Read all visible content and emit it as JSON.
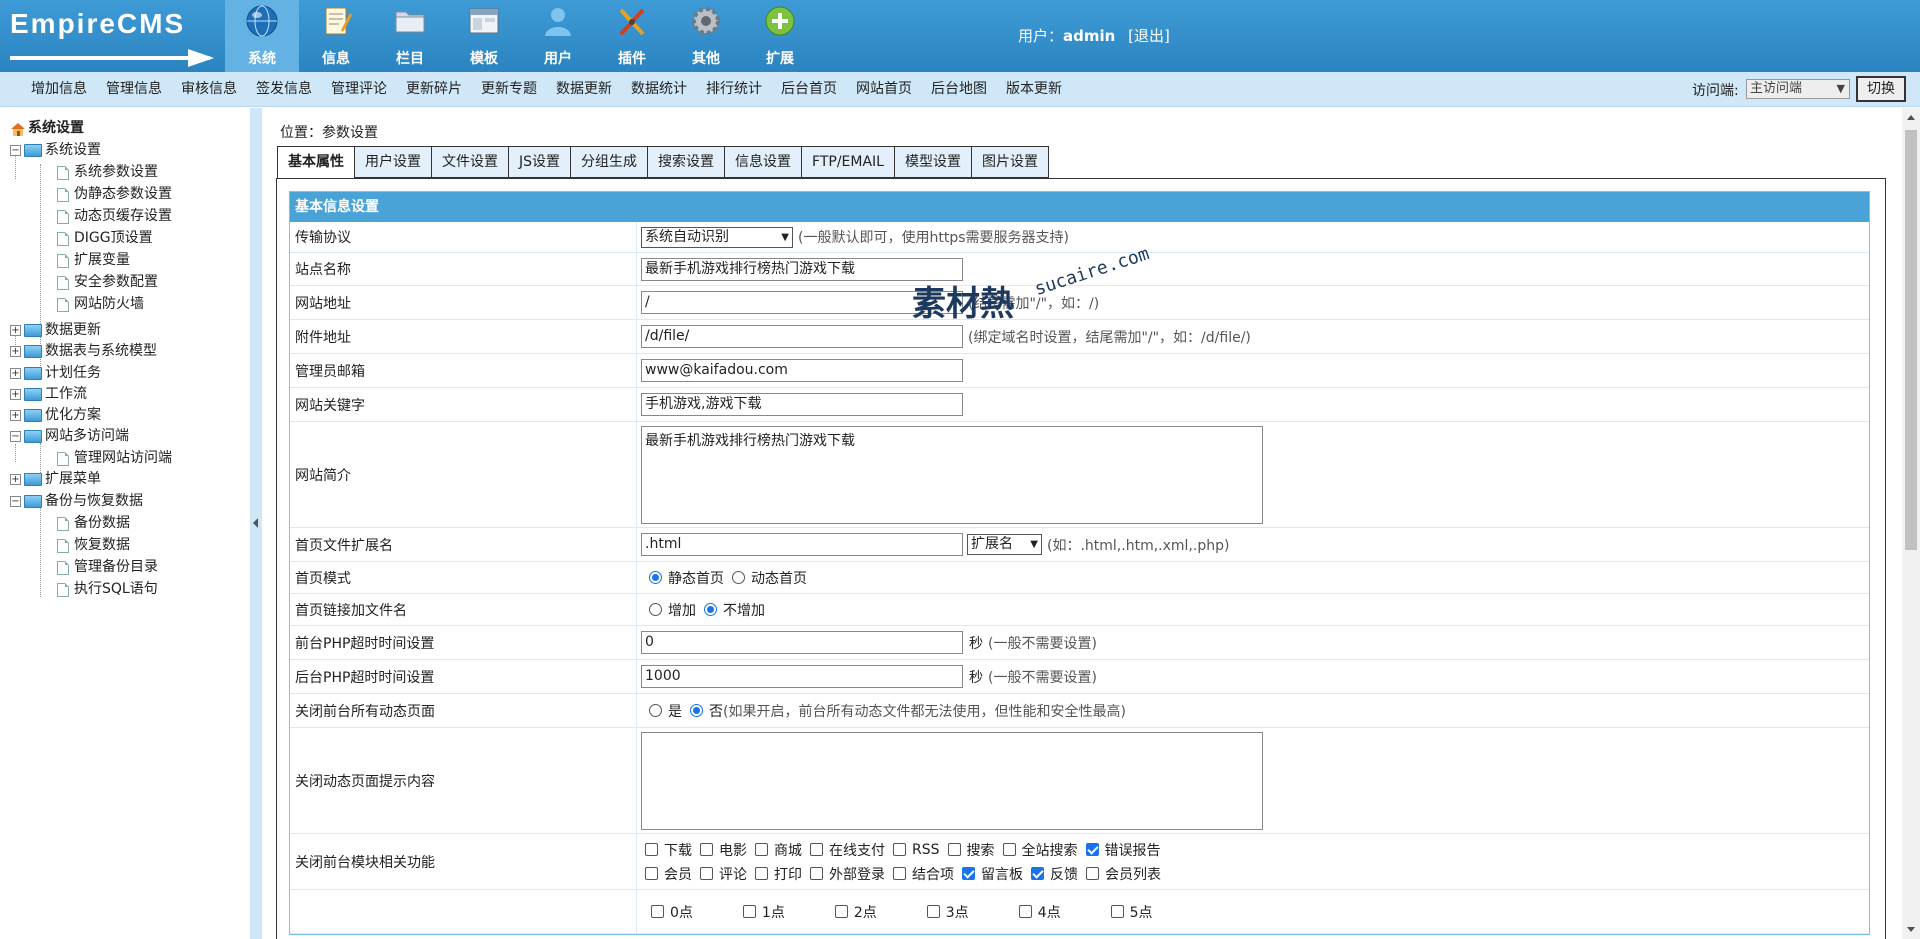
{
  "brand": {
    "logo_text": "EmpireCMS"
  },
  "main_nav": [
    {
      "label": "系统",
      "icon": "globe-icon"
    },
    {
      "label": "信息",
      "icon": "document-pen-icon"
    },
    {
      "label": "栏目",
      "icon": "folder-icon"
    },
    {
      "label": "模板",
      "icon": "window-template-icon"
    },
    {
      "label": "用户",
      "icon": "user-icon"
    },
    {
      "label": "插件",
      "icon": "tools-icon"
    },
    {
      "label": "其他",
      "icon": "gear-icon"
    },
    {
      "label": "扩展",
      "icon": "plus-circle-icon"
    }
  ],
  "user": {
    "prefix": "用户：",
    "name": "admin",
    "logout": "[退出]"
  },
  "sub_nav": [
    "增加信息",
    "管理信息",
    "审核信息",
    "签发信息",
    "管理评论",
    "更新碎片",
    "更新专题",
    "数据更新",
    "数据统计",
    "排行统计",
    "后台首页",
    "网站首页",
    "后台地图",
    "版本更新"
  ],
  "visit": {
    "label": "访问端:",
    "selected": "主访问端",
    "switch_label": "切换"
  },
  "sidebar": {
    "root": "系统设置",
    "items": [
      {
        "label": "系统设置",
        "level": 1,
        "open": true
      },
      {
        "label": "系统参数设置",
        "level": 2
      },
      {
        "label": "伪静态参数设置",
        "level": 2
      },
      {
        "label": "动态页缓存设置",
        "level": 2
      },
      {
        "label": "DIGG顶设置",
        "level": 2
      },
      {
        "label": "扩展变量",
        "level": 2
      },
      {
        "label": "安全参数配置",
        "level": 2
      },
      {
        "label": "网站防火墙",
        "level": 2
      },
      {
        "label": "数据更新",
        "level": 1,
        "open": false
      },
      {
        "label": "数据表与系统模型",
        "level": 1,
        "open": false
      },
      {
        "label": "计划任务",
        "level": 1,
        "open": false
      },
      {
        "label": "工作流",
        "level": 1,
        "open": false
      },
      {
        "label": "优化方案",
        "level": 1,
        "open": false
      },
      {
        "label": "网站多访问端",
        "level": 1,
        "open": true
      },
      {
        "label": "管理网站访问端",
        "level": 2
      },
      {
        "label": "扩展菜单",
        "level": 1,
        "open": false
      },
      {
        "label": "备份与恢复数据",
        "level": 1,
        "open": true
      },
      {
        "label": "备份数据",
        "level": 2
      },
      {
        "label": "恢复数据",
        "level": 2
      },
      {
        "label": "管理备份目录",
        "level": 2
      },
      {
        "label": "执行SQL语句",
        "level": 2
      }
    ]
  },
  "breadcrumb": {
    "prefix": "位置：",
    "current": "参数设置"
  },
  "tabs": [
    "基本属性",
    "用户设置",
    "文件设置",
    "JS设置",
    "分组生成",
    "搜索设置",
    "信息设置",
    "FTP/EMAIL",
    "模型设置",
    "图片设置"
  ],
  "form": {
    "section_title": "基本信息设置",
    "protocol": {
      "label": "传输协议",
      "value": "系统自动识别",
      "hint": "(一般默认即可，使用https需要服务器支持)"
    },
    "site_name": {
      "label": "站点名称",
      "value": "最新手机游戏排行榜热门游戏下载"
    },
    "site_url": {
      "label": "网站地址",
      "value": "/",
      "hint": "(结尾需加\"/\"，如：/)"
    },
    "attach_url": {
      "label": "附件地址",
      "value": "/d/file/",
      "hint": "(绑定域名时设置，结尾需加\"/\"，如：/d/file/)"
    },
    "admin_email": {
      "label": "管理员邮箱",
      "value": "www@kaifadou.com"
    },
    "keywords": {
      "label": "网站关键字",
      "value": "手机游戏,游戏下载"
    },
    "intro": {
      "label": "网站简介",
      "value": "最新手机游戏排行榜热门游戏下载"
    },
    "index_ext": {
      "label": "首页文件扩展名",
      "value": ".html",
      "select": "扩展名",
      "hint": "(如：.html,.htm,.xml,.php)"
    },
    "index_mode": {
      "label": "首页模式",
      "opt1": "静态首页",
      "opt2": "动态首页",
      "selected": "静态首页"
    },
    "index_link": {
      "label": "首页链接加文件名",
      "opt1": "增加",
      "opt2": "不增加",
      "selected": "不增加"
    },
    "front_timeout": {
      "label": "前台PHP超时时间设置",
      "value": "0",
      "unit": "秒",
      "hint": "(一般不需要设置)"
    },
    "back_timeout": {
      "label": "后台PHP超时时间设置",
      "value": "1000",
      "unit": "秒",
      "hint": "(一般不需要设置)"
    },
    "close_dynamic": {
      "label": "关闭前台所有动态页面",
      "opt1": "是",
      "opt2": "否",
      "selected": "否",
      "hint": "(如果开启，前台所有动态文件都无法使用，但性能和安全性最高)"
    },
    "close_tip": {
      "label": "关闭动态页面提示内容",
      "value": ""
    },
    "close_modules": {
      "label": "关闭前台模块相关功能",
      "row1": [
        {
          "label": "下载",
          "checked": false
        },
        {
          "label": "电影",
          "checked": false
        },
        {
          "label": "商城",
          "checked": false
        },
        {
          "label": "在线支付",
          "checked": false
        },
        {
          "label": "RSS",
          "checked": false
        },
        {
          "label": "搜索",
          "checked": false
        },
        {
          "label": "全站搜索",
          "checked": false
        },
        {
          "label": "错误报告",
          "checked": true
        }
      ],
      "row2": [
        {
          "label": "会员",
          "checked": false
        },
        {
          "label": "评论",
          "checked": false
        },
        {
          "label": "打印",
          "checked": false
        },
        {
          "label": "外部登录",
          "checked": false
        },
        {
          "label": "结合项",
          "checked": false
        },
        {
          "label": "留言板",
          "checked": true
        },
        {
          "label": "反馈",
          "checked": true
        },
        {
          "label": "会员列表",
          "checked": false
        }
      ]
    },
    "hours": [
      {
        "label": "0点",
        "checked": false
      },
      {
        "label": "1点",
        "checked": false
      },
      {
        "label": "2点",
        "checked": false
      },
      {
        "label": "3点",
        "checked": false
      },
      {
        "label": "4点",
        "checked": false
      },
      {
        "label": "5点",
        "checked": false
      }
    ]
  },
  "watermark": {
    "text1": "素材熱",
    "text2": "sucaire.com"
  }
}
